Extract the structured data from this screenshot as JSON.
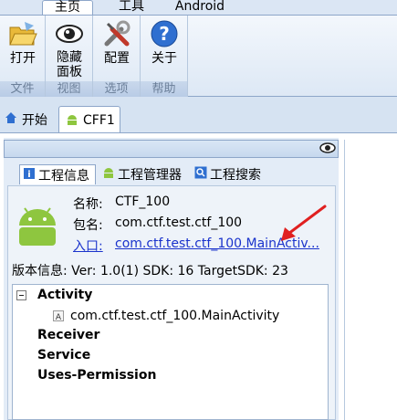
{
  "menu": {
    "tabs": [
      {
        "label": "主页"
      },
      {
        "label": "工具"
      },
      {
        "label": "Android"
      }
    ]
  },
  "ribbon": {
    "groups": [
      {
        "label": "文件",
        "buttons": [
          {
            "label": "打开",
            "icon": "folder-open-icon"
          }
        ]
      },
      {
        "label": "视图",
        "buttons": [
          {
            "label": "隐藏面板",
            "icon": "eye-icon"
          }
        ]
      },
      {
        "label": "选项",
        "buttons": [
          {
            "label": "配置",
            "icon": "tools-icon"
          }
        ]
      },
      {
        "label": "帮助",
        "buttons": [
          {
            "label": "关于",
            "icon": "help-icon"
          }
        ]
      }
    ]
  },
  "doc_tabs": [
    {
      "label": "开始",
      "icon": "home-icon"
    },
    {
      "label": "CFF1",
      "icon": "android-icon"
    }
  ],
  "panel_tabs": [
    {
      "label": "工程信息",
      "icon": "info-icon"
    },
    {
      "label": "工程管理器",
      "icon": "android-icon"
    },
    {
      "label": "工程搜索",
      "icon": "search-icon"
    }
  ],
  "project": {
    "name_label": "名称:",
    "name": "CTF_100",
    "package_label": "包名:",
    "package": "com.ctf.test.ctf_100",
    "entry_label": "入口:",
    "entry": "com.ctf.test.ctf_100.MainActiv...",
    "version_line": "版本信息: Ver: 1.0(1) SDK: 16 TargetSDK: 23"
  },
  "tree": {
    "activity_label": "Activity",
    "activity_item": "com.ctf.test.ctf_100.MainActivity",
    "receiver_label": "Receiver",
    "service_label": "Service",
    "permission_label": "Uses-Permission"
  },
  "colors": {
    "accent": "#1a33cc",
    "ribbon_bg": "#dde8f5",
    "android_green": "#8ec63f",
    "arrow_red": "#e02020"
  }
}
